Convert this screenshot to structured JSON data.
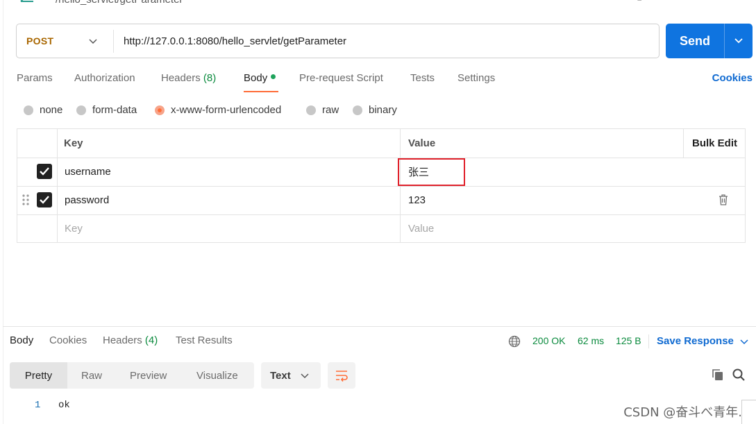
{
  "topbar": {
    "url_fragment": "/hello_servlet/getParameter"
  },
  "request": {
    "method": "POST",
    "url": "http://127.0.0.1:8080/hello_servlet/getParameter",
    "send_label": "Send"
  },
  "request_tabs": {
    "params": "Params",
    "authorization": "Authorization",
    "headers": "Headers",
    "headers_count": "(8)",
    "body": "Body",
    "prerequest": "Pre-request Script",
    "tests": "Tests",
    "settings": "Settings",
    "cookies": "Cookies"
  },
  "body_types": {
    "none": "none",
    "form_data": "form-data",
    "urlencoded": "x-www-form-urlencoded",
    "raw": "raw",
    "binary": "binary",
    "selected": "x-www-form-urlencoded"
  },
  "kv_table": {
    "headers": {
      "key": "Key",
      "value": "Value",
      "bulk_edit": "Bulk Edit"
    },
    "rows": [
      {
        "key": "username",
        "value": "张三",
        "checked": true
      },
      {
        "key": "password",
        "value": "123",
        "checked": true
      }
    ],
    "placeholder": {
      "key": "Key",
      "value": "Value"
    }
  },
  "response_tabs": {
    "body": "Body",
    "cookies": "Cookies",
    "headers": "Headers",
    "headers_count": "(4)",
    "test_results": "Test Results"
  },
  "response_meta": {
    "status": "200 OK",
    "time": "62 ms",
    "size": "125 B",
    "save_response": "Save Response"
  },
  "response_view": {
    "pretty": "Pretty",
    "raw": "Raw",
    "preview": "Preview",
    "visualize": "Visualize",
    "format": "Text"
  },
  "response_body": {
    "lines": [
      {
        "num": "1",
        "text": "ok"
      }
    ]
  },
  "watermark": "CSDN @奋斗べ青年.",
  "colors": {
    "accent": "#ff6c37",
    "send": "#0f74e0",
    "link": "#0f6ad1",
    "success": "#0a8a3d",
    "method": "#a86600",
    "highlight": "#e0202a"
  }
}
